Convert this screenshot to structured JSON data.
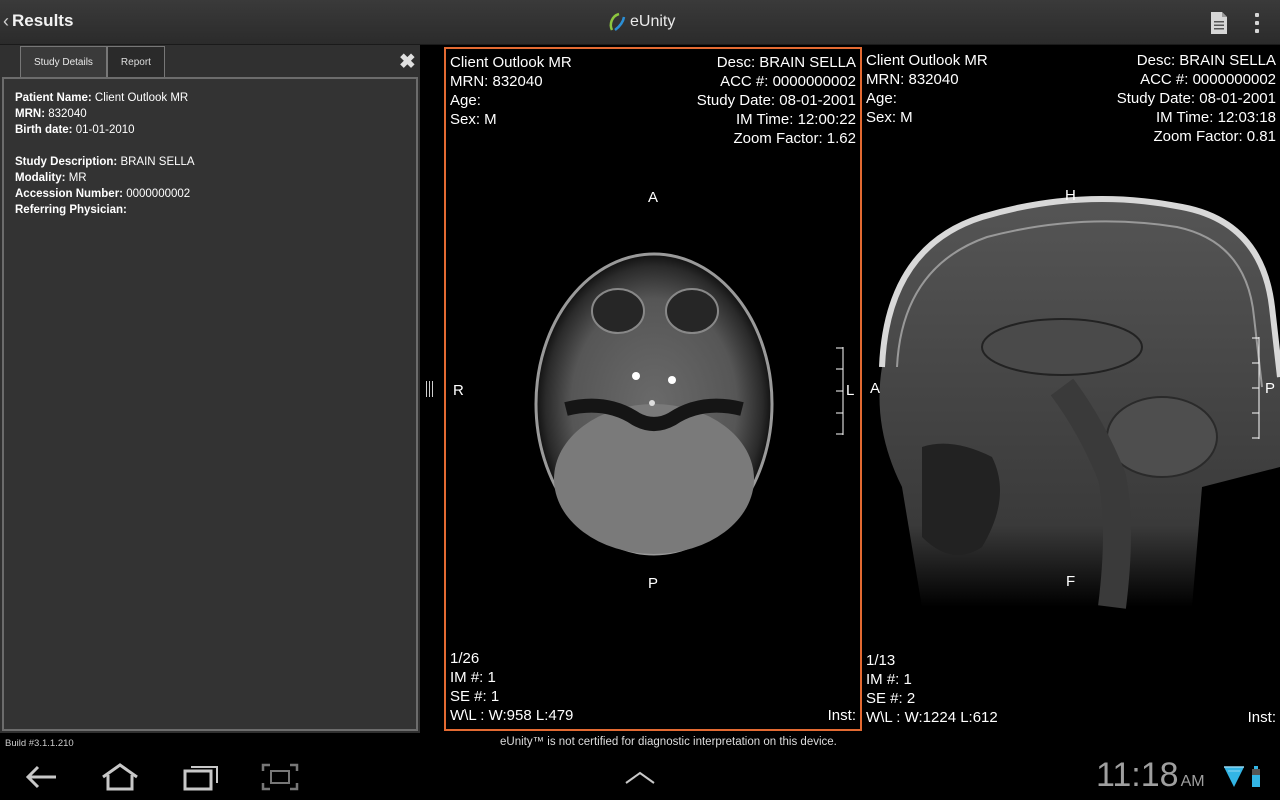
{
  "app": {
    "back_label": "Results",
    "logo_text": "eUnity"
  },
  "side_panel": {
    "tabs": [
      {
        "label": "Study Details",
        "active": true
      },
      {
        "label": "Report",
        "active": false
      }
    ],
    "patient_name_label": "Patient Name:",
    "patient_name": "Client Outlook MR",
    "mrn_label": "MRN:",
    "mrn": "832040",
    "birth_label": "Birth date:",
    "birth_date": "01-01-2010",
    "study_desc_label": "Study Description:",
    "study_desc": "BRAIN SELLA",
    "modality_label": "Modality:",
    "modality": "MR",
    "accession_label": "Accession Number:",
    "accession": "0000000002",
    "referring_label": "Referring Physician:",
    "referring": ""
  },
  "viewport1": {
    "patient": "Client Outlook MR",
    "mrn": "MRN: 832040",
    "age": "Age:",
    "sex": "Sex: M",
    "desc": "Desc: BRAIN SELLA",
    "acc": "ACC #: 0000000002",
    "study_date": "Study Date: 08-01-2001",
    "im_time": "IM Time: 12:00:22",
    "zoom": "Zoom Factor: 1.62",
    "orient_top": "A",
    "orient_bottom": "P",
    "orient_left": "R",
    "orient_right": "L",
    "image_index": "1/26",
    "im_num": "IM #: 1",
    "se_num": "SE #: 1",
    "wl": "W\\L : W:958 L:479",
    "inst": "Inst:",
    "selected": true
  },
  "viewport2": {
    "patient": "Client Outlook MR",
    "mrn": "MRN: 832040",
    "age": "Age:",
    "sex": "Sex: M",
    "desc": "Desc: BRAIN SELLA",
    "acc": "ACC #: 0000000002",
    "study_date": "Study Date: 08-01-2001",
    "im_time": "IM Time: 12:03:18",
    "zoom": "Zoom Factor: 0.81",
    "orient_top": "H",
    "orient_bottom": "F",
    "orient_left": "A",
    "orient_right": "P",
    "image_index": "1/13",
    "im_num": "IM #: 1",
    "se_num": "SE #: 2",
    "wl": "W\\L : W:1224 L:612",
    "inst": "Inst:"
  },
  "footer": {
    "build": "Build #3.1.1.210",
    "disclaimer": "eUnity™ is not certified for diagnostic interpretation on this device."
  },
  "system_bar": {
    "time": "11:18",
    "ampm": "AM",
    "icons": [
      "back-icon",
      "home-icon",
      "recent-apps-icon",
      "screenshot-icon",
      "chevron-up-icon",
      "wifi-icon",
      "battery-icon"
    ]
  },
  "colors": {
    "selected_viewport_border": "#e36a32",
    "panel_bg": "#333333"
  }
}
